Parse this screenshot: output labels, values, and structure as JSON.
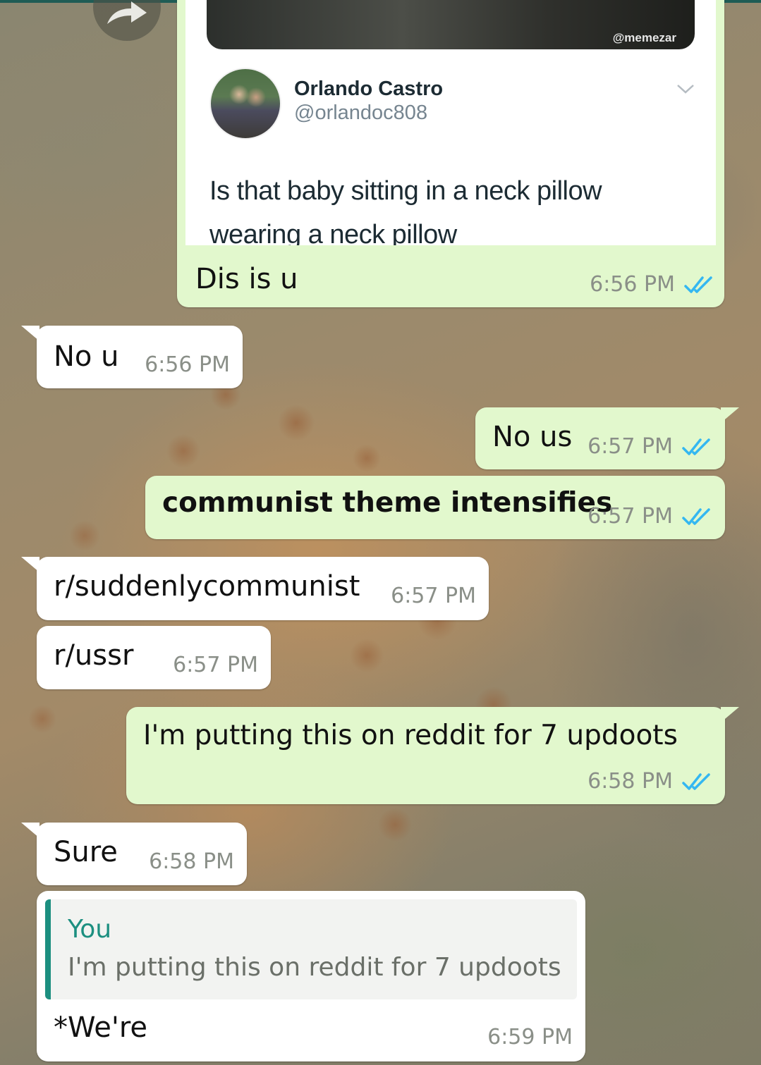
{
  "colors": {
    "outgoing_bubble": "#e2f8cd",
    "incoming_bubble": "#ffffff",
    "read_ticks": "#34b7f1",
    "reply_accent": "#1c8f80",
    "timestamp": "#8a8f88"
  },
  "icons": [
    "forward-icon",
    "double-check-read-icon",
    "chevron-down-icon"
  ],
  "tweet": {
    "watermark": "@memezar",
    "author_name": "Orlando Castro",
    "author_handle": "@orlandoc808",
    "text": "Is that baby sitting in a neck pillow wearing a neck pillow"
  },
  "messages": [
    {
      "direction": "outgoing",
      "text": "Dis is u",
      "time": "6:56 PM",
      "status": "read"
    },
    {
      "direction": "incoming",
      "text": "No u",
      "time": "6:56 PM"
    },
    {
      "direction": "outgoing",
      "text": "No us",
      "time": "6:57 PM",
      "status": "read"
    },
    {
      "direction": "outgoing",
      "text": "communist theme intensifies",
      "time": "6:57 PM",
      "status": "read"
    },
    {
      "direction": "incoming",
      "text": "r/suddenlycommunist",
      "time": "6:57 PM"
    },
    {
      "direction": "incoming",
      "text": "r/ussr",
      "time": "6:57 PM"
    },
    {
      "direction": "outgoing",
      "text": "I'm putting this on reddit for 7 updoots",
      "time": "6:58 PM",
      "status": "read"
    },
    {
      "direction": "incoming",
      "text": "Sure",
      "time": "6:58 PM"
    },
    {
      "direction": "incoming",
      "text": "*We're",
      "time": "6:59 PM",
      "reply_to": {
        "author": "You",
        "text": "I'm putting this on reddit for 7 updoots"
      }
    }
  ]
}
